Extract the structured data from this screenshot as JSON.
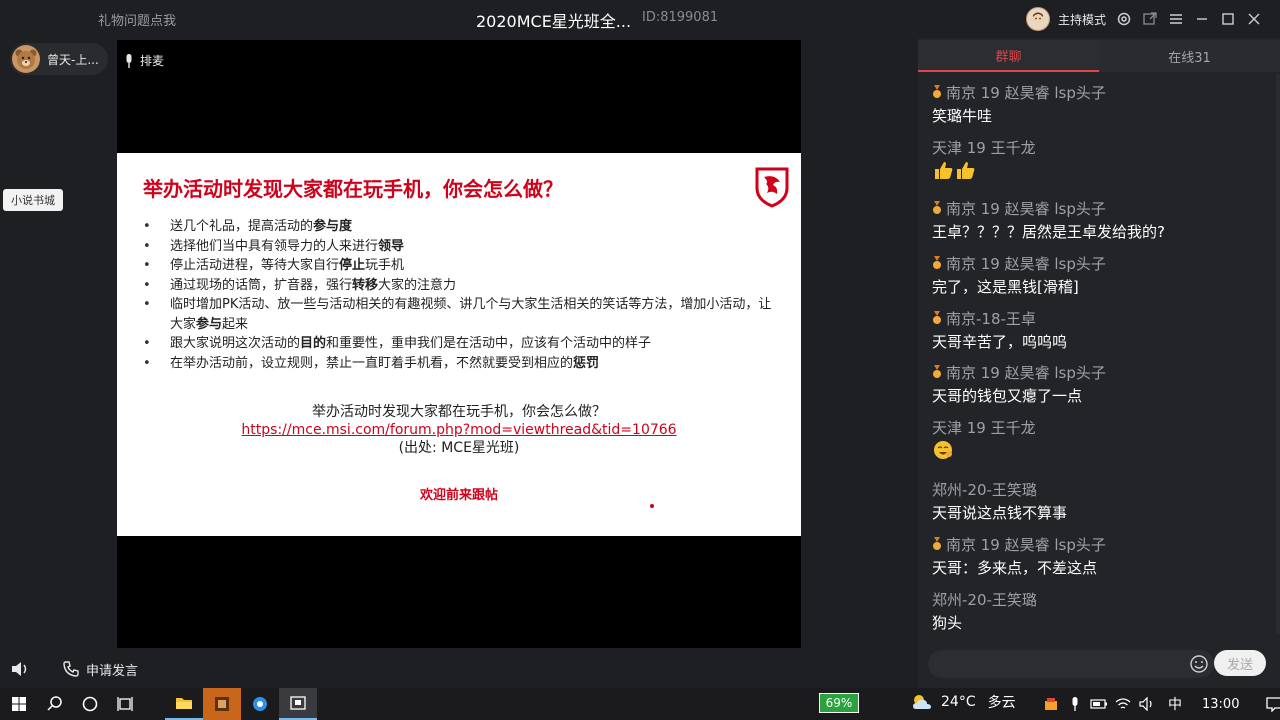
{
  "titlebar": {
    "gift_tip": "礼物问题点我",
    "room_title": "2020MCE星光班全...",
    "room_id": "ID:8199081",
    "host_mode": "主持模式"
  },
  "user_chip": {
    "name": "曾天-上..."
  },
  "side": {
    "novel_button": "小说书城"
  },
  "stage": {
    "queue_label": "排麦"
  },
  "slide": {
    "title": "举办活动时发现大家都在玩手机，你会怎么做？",
    "bullets": [
      {
        "pre": "送几个礼品，提高活动的",
        "bold": "参与度",
        "post": ""
      },
      {
        "pre": "选择他们当中具有领导力的人来进行",
        "bold": "领导",
        "post": ""
      },
      {
        "pre": "停止活动进程，等待大家自行",
        "bold": "停止",
        "post": "玩手机"
      },
      {
        "pre": "通过现场的话筒，扩音器，强行",
        "bold": "转移",
        "post": "大家的注意力"
      },
      {
        "pre": "临时增加PK活动、放一些与活动相关的有趣视频、讲几个与大家生活相关的笑话等方法，增加小活动，让大家",
        "bold": "参与",
        "post": "起来"
      },
      {
        "pre": "跟大家说明这次活动的",
        "bold": "目的",
        "post": "和重要性，重申我们是在活动中，应该有个活动中的样子"
      },
      {
        "pre": "在举办活动前，设立规则，禁止一直盯着手机看，不然就要受到相应的",
        "bold": "惩罚",
        "post": ""
      }
    ],
    "footer_question": "举办活动时发现大家都在玩手机，你会怎么做？",
    "footer_link": "https://mce.msi.com/forum.php?mod=viewthread&tid=10766",
    "footer_source": "(出处: MCE星光班)",
    "welcome": "欢迎前来跟帖"
  },
  "bottom_left": {
    "apply_speak": "申请发言"
  },
  "chat": {
    "tabs": [
      {
        "label": "群聊",
        "active": true
      },
      {
        "label": "在线31",
        "active": false
      }
    ],
    "messages": [
      {
        "name": "南京 19 赵昊睿 lsp头子",
        "badge": true,
        "text": "笑璐牛哇",
        "icon": ""
      },
      {
        "name": "天津  19 王千龙",
        "badge": false,
        "text": "",
        "icon": "thumbs-up-icon"
      },
      {
        "name": "南京 19 赵昊睿 lsp头子",
        "badge": true,
        "text": "王卓？？？？居然是王卓发给我的?",
        "icon": ""
      },
      {
        "name": "南京 19 赵昊睿 lsp头子",
        "badge": true,
        "text": "完了，这是黑钱[滑稽]",
        "icon": ""
      },
      {
        "name": "南京-18-王卓",
        "badge": true,
        "text": "天哥辛苦了，呜呜呜",
        "icon": ""
      },
      {
        "name": "南京 19 赵昊睿 lsp头子",
        "badge": true,
        "text": "天哥的钱包又瘪了一点",
        "icon": ""
      },
      {
        "name": "天津  19 王千龙",
        "badge": false,
        "text": "",
        "icon": "emoji-icon"
      },
      {
        "name": "郑州-20-王笑璐",
        "badge": false,
        "text": "天哥说这点钱不算事",
        "icon": ""
      },
      {
        "name": "南京 19 赵昊睿 lsp头子",
        "badge": true,
        "text": "天哥：多来点，不差这点",
        "icon": ""
      },
      {
        "name": "郑州-20-王笑璐",
        "badge": false,
        "text": "狗头",
        "icon": ""
      }
    ],
    "send_label": "发送"
  },
  "taskbar": {
    "battery": "69%",
    "temperature": "24°C",
    "weather": "多云",
    "ime": "中",
    "time": "13:00"
  },
  "colors": {
    "accent_red": "#d0021b",
    "tab_active": "#e0434b",
    "battery_green": "#2aa33e"
  }
}
